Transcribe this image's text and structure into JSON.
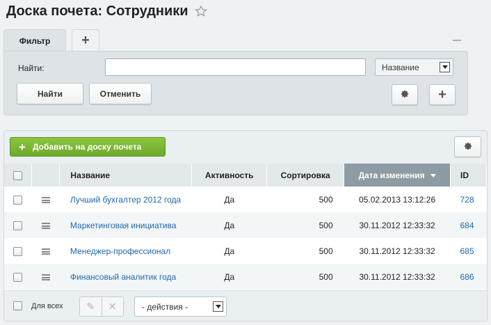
{
  "page": {
    "title": "Доска почета: Сотрудники"
  },
  "filter": {
    "tab_label": "Фильтр",
    "add_tab_label": "+",
    "find_label": "Найти:",
    "search_value": "",
    "select_value": "Название",
    "find_button": "Найти",
    "cancel_button": "Отменить",
    "plus_button": "+"
  },
  "list": {
    "add_button": "Добавить на доску почета",
    "columns": {
      "name": "Название",
      "activity": "Активность",
      "sort": "Сортировка",
      "date": "Дата изменения",
      "id": "ID"
    },
    "rows": [
      {
        "name": "Лучший бухгалтер 2012 года",
        "activity": "Да",
        "sort": "500",
        "date": "05.02.2013 13:12:26",
        "id": "728"
      },
      {
        "name": "Маркетинговая инициатива",
        "activity": "Да",
        "sort": "500",
        "date": "30.11.2012 12:33:32",
        "id": "684"
      },
      {
        "name": "Менеджер-профессионал",
        "activity": "Да",
        "sort": "500",
        "date": "30.11.2012 12:33:32",
        "id": "685"
      },
      {
        "name": "Финансовый аналитик года",
        "activity": "Да",
        "sort": "500",
        "date": "30.11.2012 12:33:32",
        "id": "686"
      }
    ],
    "footer": {
      "for_all_label": "Для всех",
      "actions_value": "- действия -"
    }
  },
  "colors": {
    "accent_green": "#7ab834",
    "link_blue": "#2067b0",
    "sorted_header": "#8d9ba2"
  }
}
